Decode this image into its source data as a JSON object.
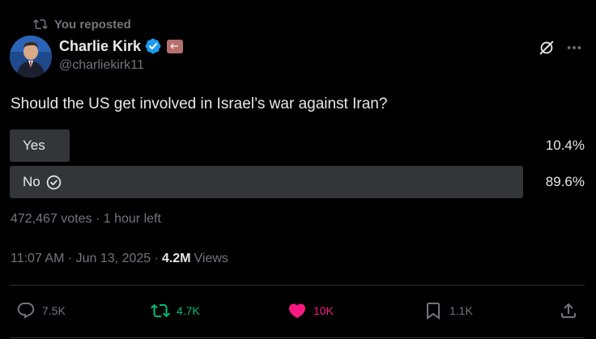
{
  "repost": {
    "label": "You reposted",
    "icon": "repost-icon"
  },
  "author": {
    "name": "Charlie Kirk",
    "handle": "@charliekirk11",
    "verified_icon": "verified-badge-icon",
    "affiliation_icon": "affiliation-badge-icon"
  },
  "header_actions": {
    "grok_icon": "grok-icon",
    "more_icon": "more-icon"
  },
  "post": {
    "question": "Should the US get involved in Israel’s war against Iran?"
  },
  "poll": {
    "options": [
      {
        "label": "Yes",
        "percent": "10.4%",
        "fraction": 0.104,
        "selected": false
      },
      {
        "label": "No",
        "percent": "89.6%",
        "fraction": 0.896,
        "selected": true
      }
    ],
    "votes": "472,467 votes",
    "time_left": "1 hour left"
  },
  "timestamp": {
    "time": "11:07 AM",
    "date": "Jun 13, 2025",
    "views_count": "4.2M",
    "views_label": "Views"
  },
  "actions": {
    "reply": {
      "count": "7.5K",
      "icon": "reply-icon"
    },
    "repost": {
      "count": "4.7K",
      "icon": "repost-icon"
    },
    "like": {
      "count": "10K",
      "icon": "heart-icon"
    },
    "bookmark": {
      "count": "1.1K",
      "icon": "bookmark-icon"
    },
    "share": {
      "icon": "share-icon"
    }
  },
  "colors": {
    "background": "#000000",
    "text_primary": "#e7e9ea",
    "text_secondary": "#71767b",
    "poll_bar": "#333639",
    "repost_active": "#00ba7c",
    "like_active": "#f91880",
    "verified": "#1d9bf0",
    "divider": "#2f3336"
  }
}
